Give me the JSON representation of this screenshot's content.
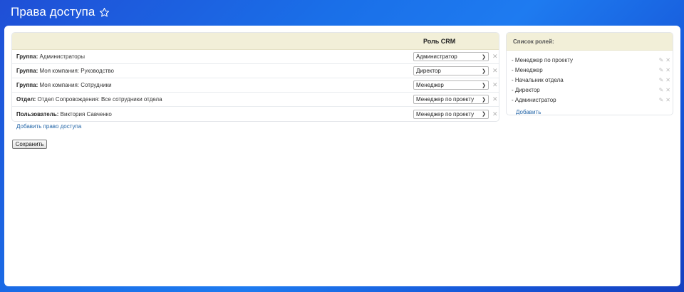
{
  "header": {
    "title": "Права доступа",
    "star_icon": "star-icon"
  },
  "table": {
    "role_column_header": "Роль CRM",
    "rows": [
      {
        "type": "Группа:",
        "name": "Администраторы",
        "role": "Администратор"
      },
      {
        "type": "Группа:",
        "name": "Моя компания: Руководство",
        "role": "Директор"
      },
      {
        "type": "Группа:",
        "name": "Моя компания: Сотрудники",
        "role": "Менеджер"
      },
      {
        "type": "Отдел:",
        "name": "Отдел Сопровождения: Все сотрудники отдела",
        "role": "Менеджер по проекту"
      },
      {
        "type": "Пользователь:",
        "name": "Виктория Савченко",
        "role": "Менеджер по проекту"
      }
    ],
    "add_link": "Добавить право доступа"
  },
  "save_button": "Сохранить",
  "roles": {
    "title": "Список ролей:",
    "items": [
      {
        "label": "- Менеджер по проекту"
      },
      {
        "label": "- Менеджер"
      },
      {
        "label": "- Начальник отдела"
      },
      {
        "label": "- Директор"
      },
      {
        "label": "- Администратор"
      }
    ],
    "add_link": "Добавить"
  },
  "colors": {
    "header_bg": "#f2efd8",
    "link": "#2466a8",
    "background": "#1a6fe8"
  }
}
